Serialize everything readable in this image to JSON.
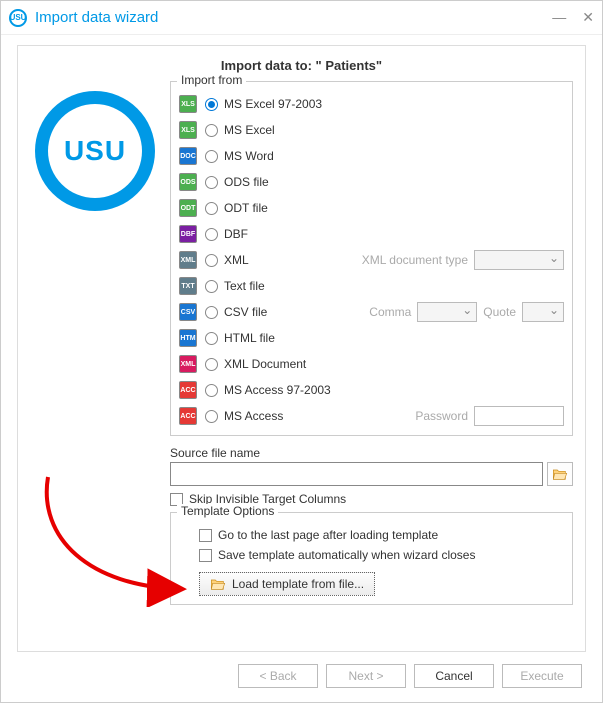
{
  "window": {
    "title": "Import data wizard"
  },
  "heading_prefix": "Import data to: \"",
  "heading_target": " Patients",
  "heading_suffix": "\"",
  "logo_text": "USU",
  "import_from": {
    "legend": "Import from",
    "options": [
      {
        "label": "MS Excel 97-2003",
        "color": "#4caf50",
        "tag": "XLS",
        "checked": true
      },
      {
        "label": "MS Excel",
        "color": "#4caf50",
        "tag": "XLS"
      },
      {
        "label": "MS Word",
        "color": "#1976d2",
        "tag": "DOC"
      },
      {
        "label": "ODS file",
        "color": "#4caf50",
        "tag": "ODS"
      },
      {
        "label": "ODT file",
        "color": "#4caf50",
        "tag": "ODT"
      },
      {
        "label": "DBF",
        "color": "#7b1fa2",
        "tag": "DBF"
      },
      {
        "label": "XML",
        "color": "#607d8b",
        "tag": "XML",
        "extra": "xml"
      },
      {
        "label": "Text file",
        "color": "#607d8b",
        "tag": "TXT"
      },
      {
        "label": "CSV file",
        "color": "#1976d2",
        "tag": "CSV",
        "extra": "csv"
      },
      {
        "label": "HTML file",
        "color": "#1976d2",
        "tag": "HTM"
      },
      {
        "label": "XML Document",
        "color": "#d81b60",
        "tag": "XML"
      },
      {
        "label": "MS Access 97-2003",
        "color": "#e53935",
        "tag": "ACC"
      },
      {
        "label": "MS Access",
        "color": "#e53935",
        "tag": "ACC",
        "extra": "access"
      }
    ]
  },
  "extras": {
    "xml_label": "XML document type",
    "comma_label": "Comma",
    "quote_label": "Quote",
    "password_label": "Password"
  },
  "source": {
    "label": "Source file name",
    "value": ""
  },
  "skip_invisible_label": "Skip Invisible Target Columns",
  "template": {
    "legend": "Template Options",
    "goto_last_label": "Go to the last page after loading template",
    "autosave_label": "Save template automatically when wizard closes",
    "load_btn_label": "Load template from file..."
  },
  "buttons": {
    "back": "< Back",
    "next": "Next >",
    "cancel": "Cancel",
    "execute": "Execute"
  }
}
